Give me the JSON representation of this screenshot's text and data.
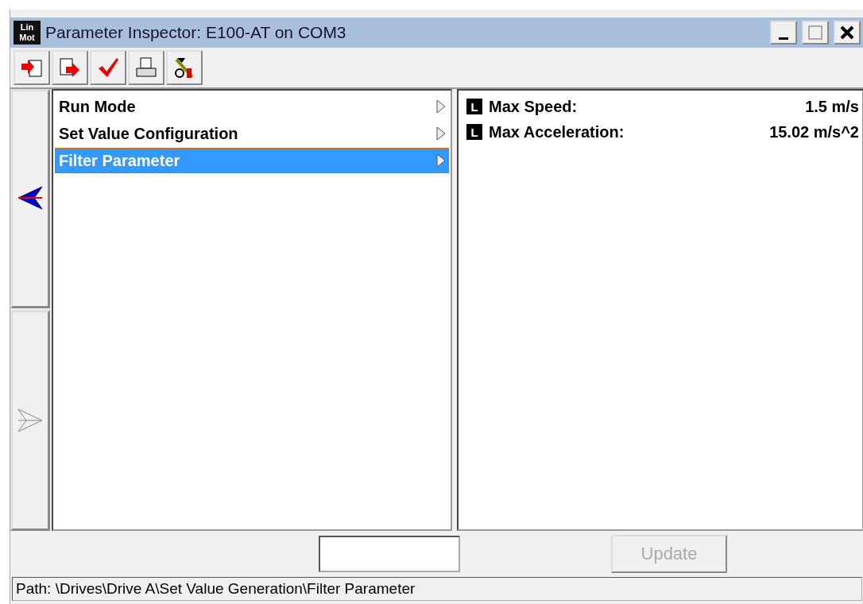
{
  "window": {
    "logo": [
      "Lin",
      "Mot"
    ],
    "title": "Parameter Inspector: E100-AT on COM3"
  },
  "toolbar": [
    {
      "kind": "import"
    },
    {
      "kind": "export"
    },
    {
      "kind": "check"
    },
    {
      "kind": "print"
    },
    {
      "kind": "tools"
    }
  ],
  "nav": [
    {
      "kind": "back",
      "disabled": false
    },
    {
      "kind": "forward",
      "disabled": true
    }
  ],
  "menu_items": [
    {
      "label": "Run Mode",
      "selected": false
    },
    {
      "label": "Set Value Configuration",
      "selected": false
    },
    {
      "label": "Filter Parameter",
      "selected": true
    }
  ],
  "parameters": [
    {
      "badge": "L",
      "name": "Max Speed:",
      "value": "1.5 m/s"
    },
    {
      "badge": "L",
      "name": "Max Acceleration:",
      "value": "15.02 m/s^2"
    }
  ],
  "update_button": {
    "label": "Update",
    "disabled": true
  },
  "status_bar": "Path: \\Drives\\Drive A\\Set Value Generation\\Filter Parameter"
}
